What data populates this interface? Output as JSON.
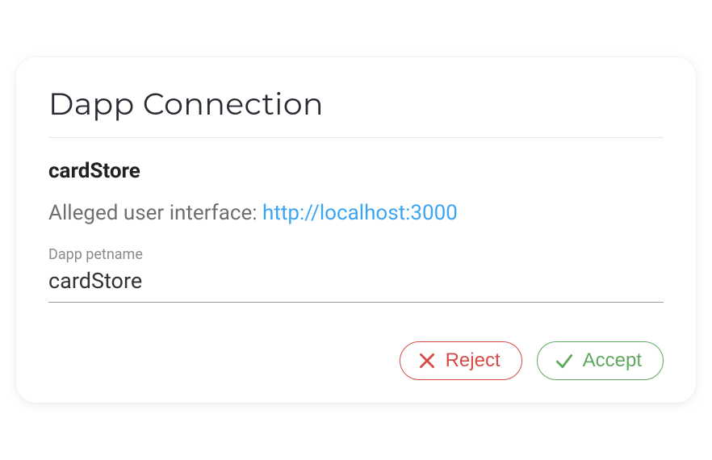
{
  "card": {
    "title": "Dapp Connection",
    "dapp_name": "cardStore",
    "alleged_prefix": "Alleged user interface: ",
    "alleged_url": "http://localhost:3000",
    "petname_label": "Dapp petname",
    "petname_value": "cardStore"
  },
  "actions": {
    "reject_label": "Reject",
    "accept_label": "Accept"
  }
}
